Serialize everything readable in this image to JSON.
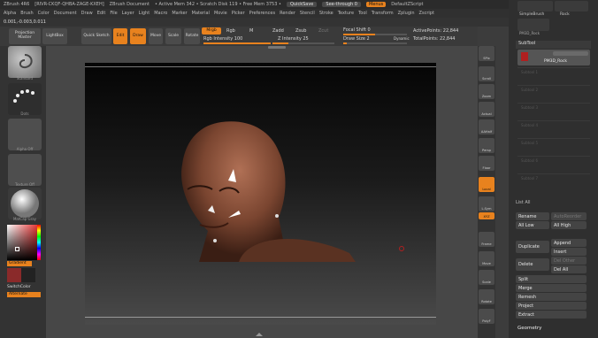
{
  "titlebar": {
    "app": "ZBrush 4R6",
    "serial": "[RIVR-CKQF-QHBA-ZAGE-KXEH]",
    "document": "ZBrush Document",
    "mem": "• Active Mem 342 • Scratch Disk 119 • Free Mem 3753 •",
    "quicksave": "QuickSave",
    "seethrough": "See-through  0",
    "menus": "Menus",
    "script": "DefaultZScript"
  },
  "menubar": [
    "Alpha",
    "Brush",
    "Color",
    "Document",
    "Draw",
    "Edit",
    "File",
    "Layer",
    "Light",
    "Macro",
    "Marker",
    "Material",
    "Movie",
    "Picker",
    "Preferences",
    "Render",
    "Stencil",
    "Stroke",
    "Texture",
    "Tool",
    "Transform",
    "Zplugin",
    "Zscript"
  ],
  "coords": "0.001,-0.003,0.011",
  "toolbar": {
    "projection_master": "Projection Master",
    "lightbox": "LightBox",
    "quick_sketch": "Quick Sketch",
    "edit": "Edit",
    "draw": "Draw",
    "move": "Move",
    "scale": "Scale",
    "rotate": "Rotate",
    "mrgb": "Mrgb",
    "rgb": "Rgb",
    "m": "M",
    "rgb_intensity": "Rgb Intensity 100",
    "zadd": "Zadd",
    "zsub": "Zsub",
    "zcut": "Zcut",
    "z_intensity": "Z Intensity 25",
    "focal_shift": "Focal Shift 0",
    "draw_size": "Draw Size 2",
    "dynamic": "Dynamic",
    "active_points": "ActivePoints: 22,844",
    "total_points": "TotalPoints: 22,844"
  },
  "leftpanel": {
    "swatches": [
      "Standard",
      "Dots",
      "Alpha Off",
      "Texture Off",
      "MatCap Gray"
    ],
    "gradient": "Gradient",
    "switchcolor": "SwitchColor",
    "alternate": "Alternate"
  },
  "rightbar": [
    "SPix",
    "Scroll",
    "Zoom",
    "Actual",
    "AAHalf",
    "Persp",
    "Floor",
    "Local",
    "L.Sym",
    "XYZ",
    "Frame",
    "Move",
    "Scale",
    "Rotate",
    "PolyF"
  ],
  "rightpanel": {
    "top_tools": [
      "SimpleBrush",
      "Rock"
    ],
    "pmod": "PM3D_Rock",
    "subtool_title": "SubTool",
    "subtool_active": "PM3D_Rock",
    "subtool_slots": [
      "Subtool 1",
      "Subtool 2",
      "Subtool 3",
      "Subtool 4",
      "Subtool 5",
      "Subtool 6",
      "Subtool 7"
    ],
    "list_all": "List All",
    "rename": "Rename",
    "autoreorder": "AutoReorder",
    "all_low": "All Low",
    "all_high": "All High",
    "duplicate": "Duplicate",
    "append": "Append",
    "insert": "Insert",
    "delete": "Delete",
    "del_other": "Del Other",
    "del_all": "Del All",
    "split": "Split",
    "merge": "Merge",
    "remesh": "Remesh",
    "project": "Project",
    "extract": "Extract",
    "geometry": "Geometry"
  }
}
